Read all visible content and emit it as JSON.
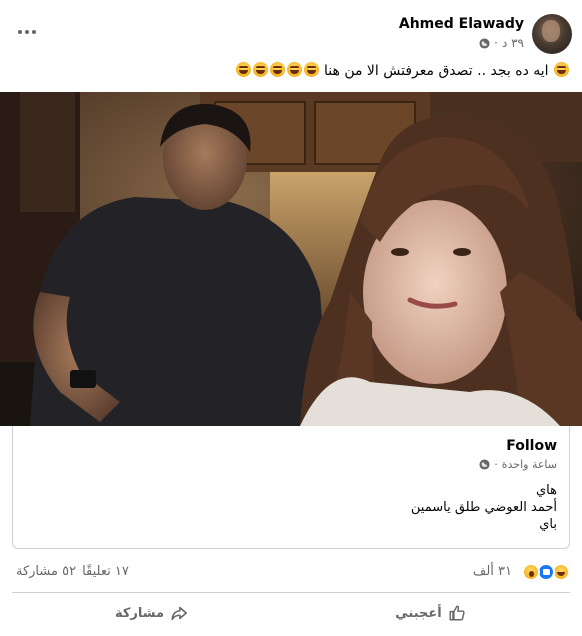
{
  "post": {
    "author_name": "Ahmed Elawady",
    "time": "٣٩ د",
    "text": "ايه ده بجد .. تصدق معرفتش الا من هنا",
    "emoji_count_before": 5,
    "emoji_count_after": 1
  },
  "shared": {
    "follow_label": "Follow",
    "time": "ساعة واحدة",
    "lines": [
      "هاي",
      "أحمد العوضي طلق ياسمين",
      "باي"
    ]
  },
  "stats": {
    "reactions_count": "٣١ ألف",
    "comments": "١٧ تعليقًا",
    "shares": "٥٢ مشاركة"
  },
  "actions": {
    "like_label": "أعجبني",
    "share_label": "مشاركة"
  },
  "icons": {
    "more": "more-dots-icon",
    "privacy": "globe-icon",
    "like": "thumbs-up-icon",
    "share": "share-arrow-icon"
  },
  "colors": {
    "meta_text": "#65676b",
    "primary_text": "#050505",
    "like_blue": "#1877f2",
    "border": "#ced0d4"
  }
}
